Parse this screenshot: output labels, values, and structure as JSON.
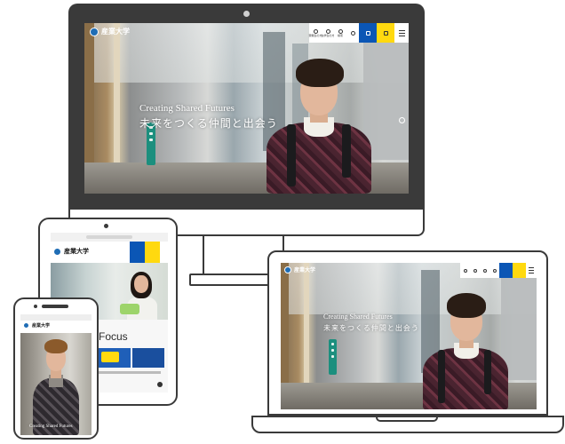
{
  "site": {
    "logo_text": "産業大学",
    "hero_en": "Creating Shared Futures",
    "hero_jp": "未来をつくる仲間と出会う",
    "focus_heading": "Focus"
  },
  "desktop_nav": [
    "受験生の方",
    "在学生の方",
    "検索",
    "MENU"
  ],
  "colors": {
    "nav_blue": "#0b56b5",
    "nav_yellow": "#ffd90f",
    "sign_green": "#1c8f7e",
    "bezel": "#3a3a3a"
  }
}
